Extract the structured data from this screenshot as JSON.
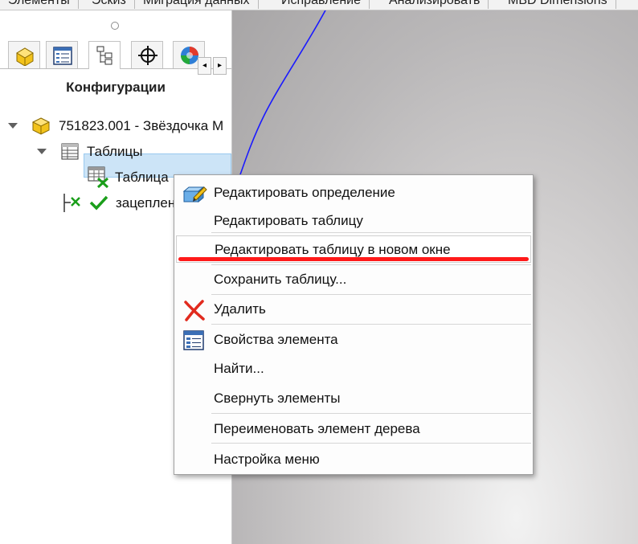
{
  "command_tabs": [
    "Элементы",
    "Эскиз",
    "Миграция данных",
    "Исправление",
    "Анализировать",
    "MBD Dimensions"
  ],
  "panel": {
    "tabs": [
      "part-icon",
      "feature-list-icon",
      "config-tree-icon",
      "target-icon",
      "appearance-icon"
    ],
    "scroll_left": "◂",
    "scroll_right": "▸",
    "title": "Конфигурации"
  },
  "tree": {
    "root_label": "751823.001 - Звёздочка М",
    "tables_label": "Таблицы",
    "table_label": "Таблица",
    "config_label": "зацеплен"
  },
  "context_menu": {
    "items": [
      {
        "label": "Редактировать определение",
        "icon": "edit-definition-icon"
      },
      {
        "label": "Редактировать таблицу",
        "icon": ""
      },
      {
        "label": "Редактировать таблицу в новом окне",
        "icon": ""
      },
      {
        "label": "Сохранить таблицу...",
        "icon": ""
      },
      {
        "label": "Удалить",
        "icon": "delete-icon"
      },
      {
        "label": "Свойства элемента",
        "icon": "properties-icon"
      },
      {
        "label": "Найти...",
        "icon": ""
      },
      {
        "label": "Свернуть элементы",
        "icon": ""
      },
      {
        "label": "Переименовать элемент дерева",
        "icon": ""
      },
      {
        "label": "Настройка меню",
        "icon": ""
      }
    ],
    "highlighted_index": 2,
    "annotation_color": "#ff1a1a"
  },
  "colors": {
    "selection": "#cce4f7",
    "curve": "#1a1aff",
    "check": "#1a9e1a"
  }
}
